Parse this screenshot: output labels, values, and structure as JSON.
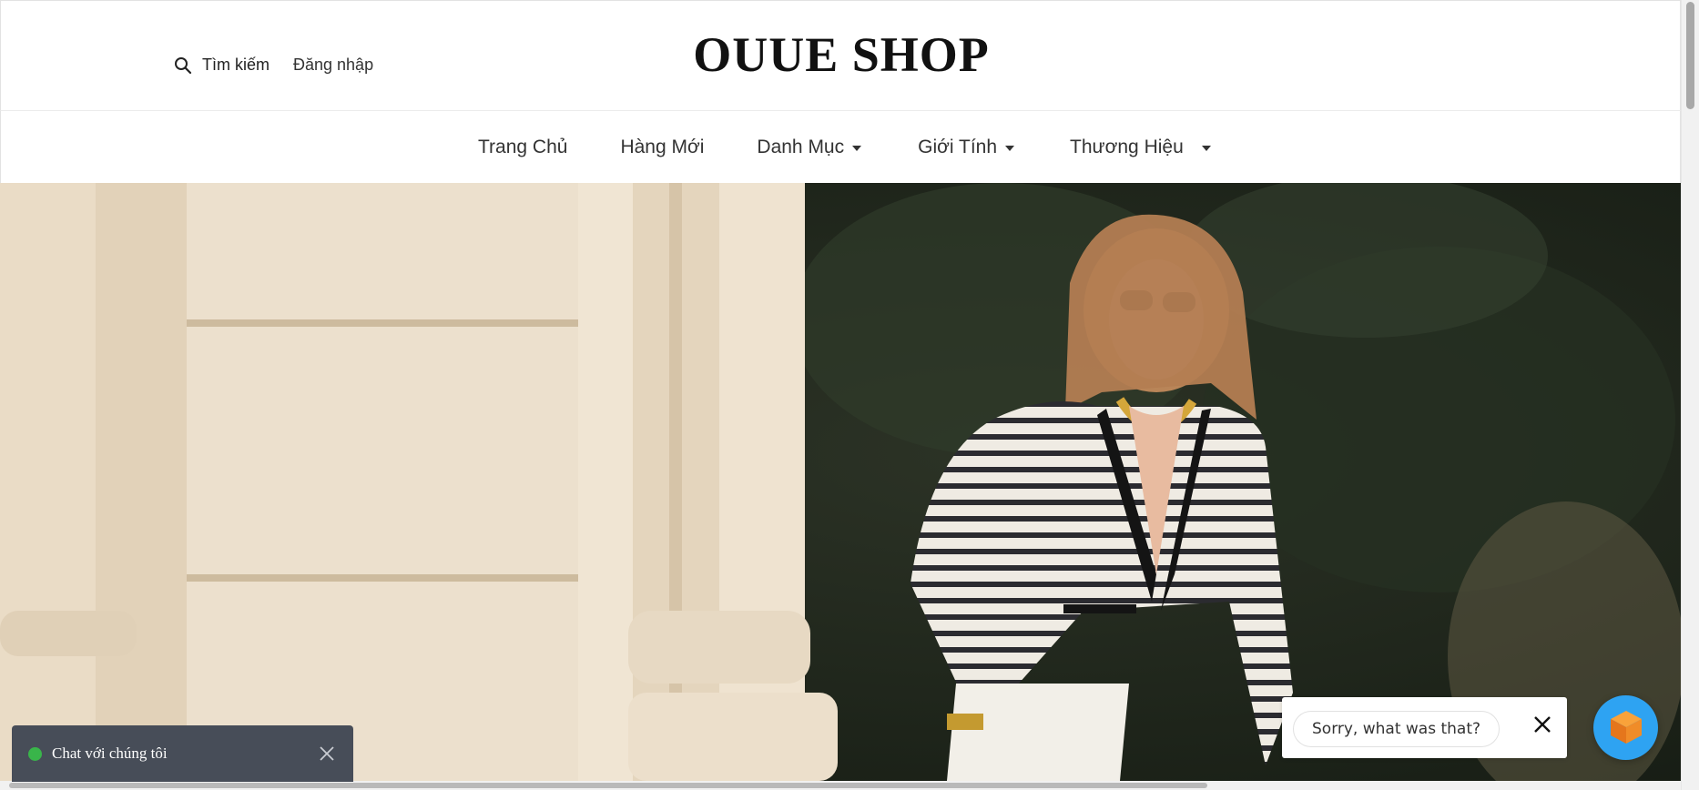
{
  "header": {
    "search_label": "Tìm kiếm",
    "login_label": "Đăng nhập",
    "brand": "OUUE SHOP"
  },
  "nav": {
    "items": [
      {
        "label": "Trang Chủ"
      },
      {
        "label": "Hàng Mới"
      },
      {
        "label": "Danh Mục"
      },
      {
        "label": "Giới Tính"
      },
      {
        "label": "Thương Hiệu"
      }
    ]
  },
  "chat": {
    "label": "Chat với chúng tôi",
    "status_color": "#39b54a",
    "bar_color": "#474d58"
  },
  "assistant": {
    "message": "Sorry, what was that?",
    "launcher_color": "#2ea3f2"
  },
  "icons": {
    "search": "search-icon",
    "close": "close-icon",
    "chevron": "chevron-down-icon",
    "chat_launcher": "cube-icon"
  }
}
